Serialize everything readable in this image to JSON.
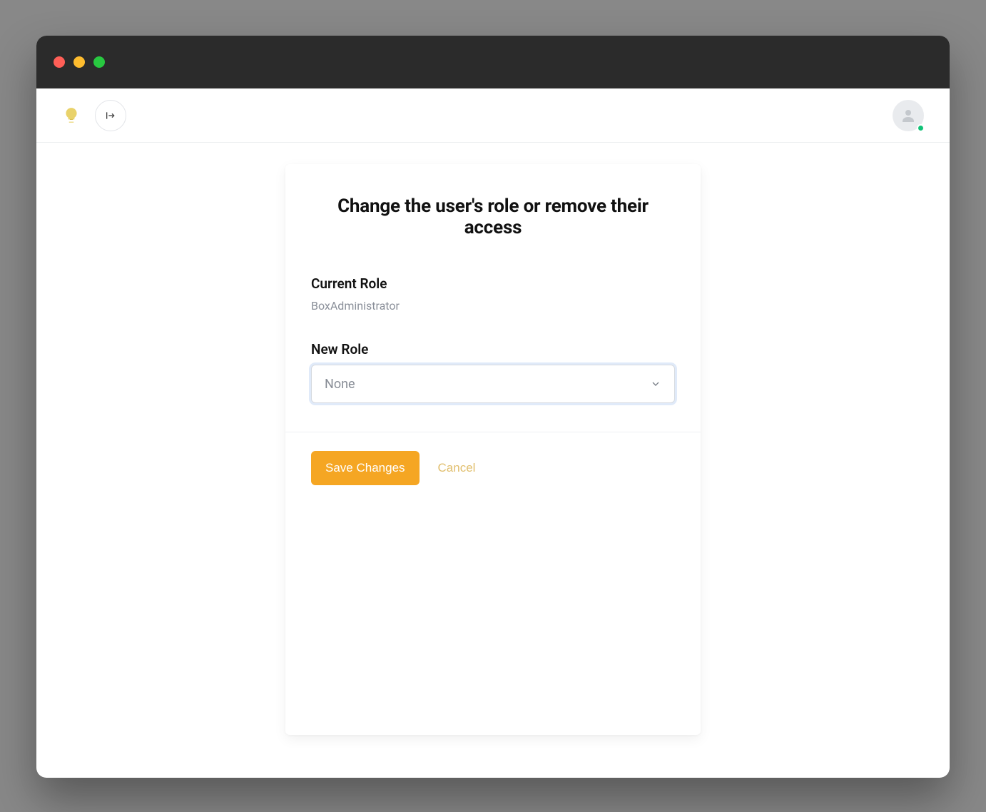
{
  "card": {
    "title": "Change the user's role or remove their access",
    "current_role_label": "Current Role",
    "current_role_value": "BoxAdministrator",
    "new_role_label": "New Role",
    "new_role_selected": "None"
  },
  "actions": {
    "save_label": "Save Changes",
    "cancel_label": "Cancel"
  }
}
